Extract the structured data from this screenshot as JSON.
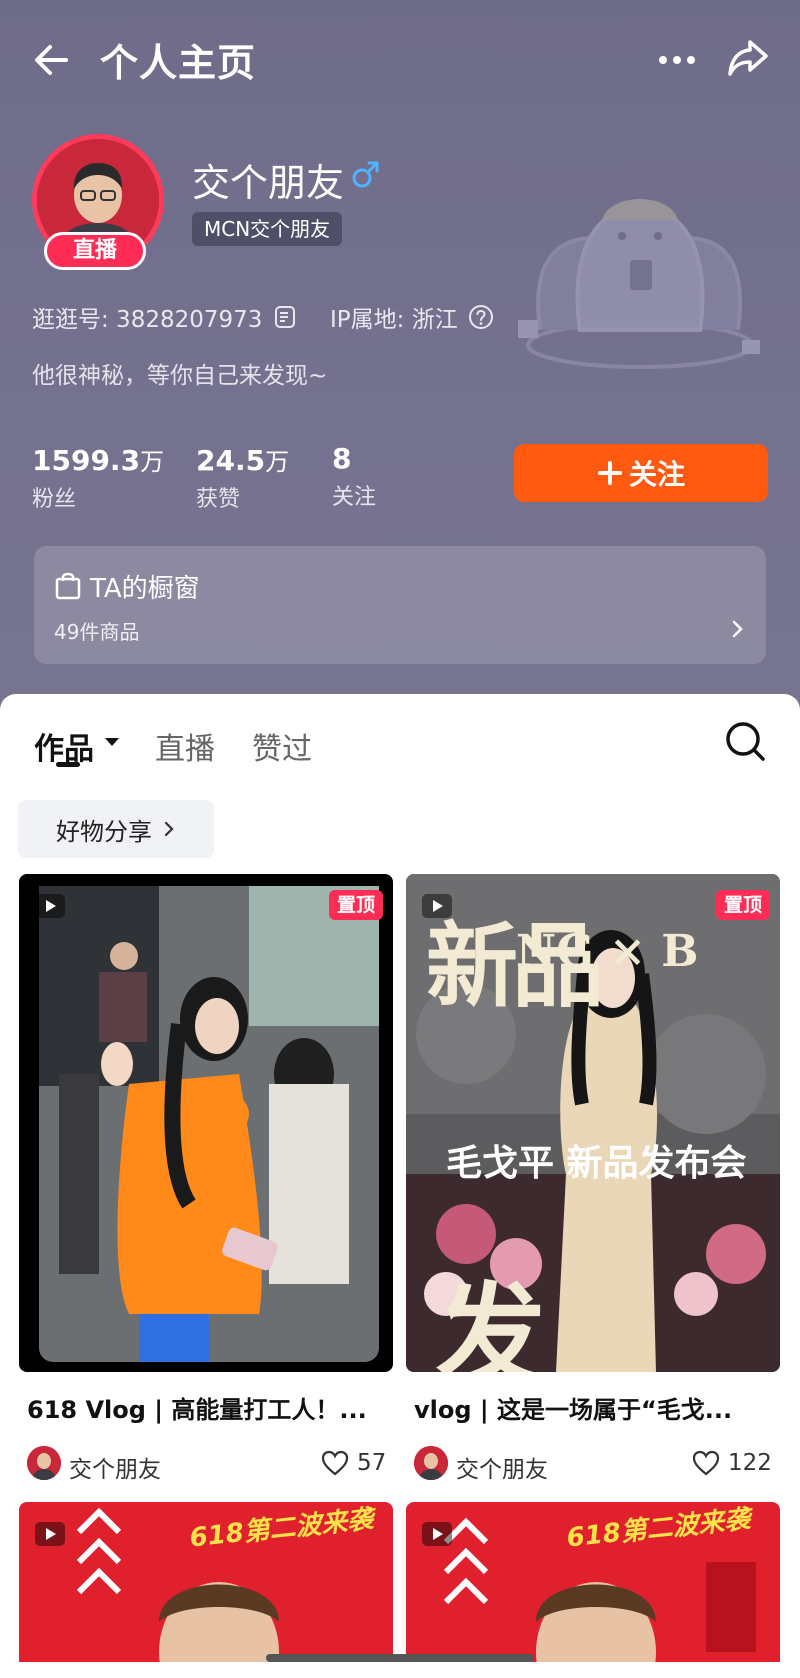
{
  "header": {
    "title": "个人主页"
  },
  "profile": {
    "name": "交个朋友",
    "live_badge": "直播",
    "mcn_tag": "MCN交个朋友",
    "id_text": "逛逛号: 3828207973",
    "ip_text": "IP属地: 浙江",
    "bio": "他很神秘，等你自己来发现~"
  },
  "stats": [
    {
      "value": "1599.3",
      "unit": "万",
      "label": "粉丝"
    },
    {
      "value": "24.5",
      "unit": "万",
      "label": "获赞"
    },
    {
      "value": "8",
      "unit": "",
      "label": "关注"
    }
  ],
  "follow_button": {
    "label": "关注"
  },
  "shop": {
    "title": "TA的橱窗",
    "count": "49件商品"
  },
  "tabs": [
    {
      "label": "作品"
    },
    {
      "label": "直播"
    },
    {
      "label": "赞过"
    }
  ],
  "filter_chip": {
    "label": "好物分享"
  },
  "cards": [
    {
      "title": "618 Vlog | 高能量打工人！...",
      "pin_label": "置顶",
      "author": "交个朋友",
      "likes": "57"
    },
    {
      "title": "vlog | 这是一场属于“毛戈...",
      "pin_label": "置顶",
      "author": "交个朋友",
      "likes": "122",
      "overlay_top": "新品",
      "overlay_brand": "NG × B",
      "overlay_mid": "毛戈平 新品发布会",
      "overlay_bottom": "发布"
    }
  ],
  "banner_text": "618第二波来袭",
  "colors": {
    "header_bg": "#726f8d",
    "follow_orange": "#ff5a0f",
    "live_pink": "#ff2d55",
    "gender_blue": "#4fb3ff"
  }
}
